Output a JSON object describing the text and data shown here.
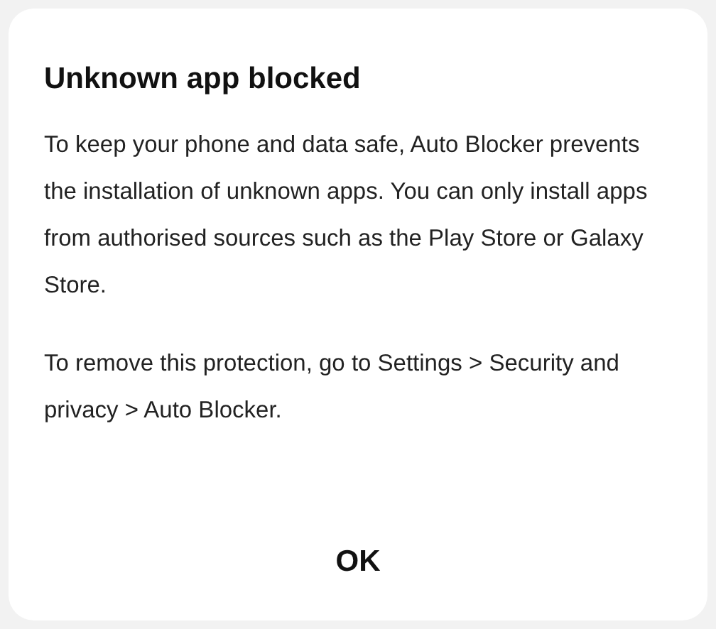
{
  "dialog": {
    "title": "Unknown app blocked",
    "paragraphs": [
      "To keep your phone and data safe, Auto Blocker prevents the installation of unknown apps. You can only install apps from authorised sources such as the Play Store or Galaxy Store.",
      "To remove this protection, go to Settings > Security and privacy > Auto Blocker."
    ],
    "buttons": [
      "OK"
    ]
  }
}
